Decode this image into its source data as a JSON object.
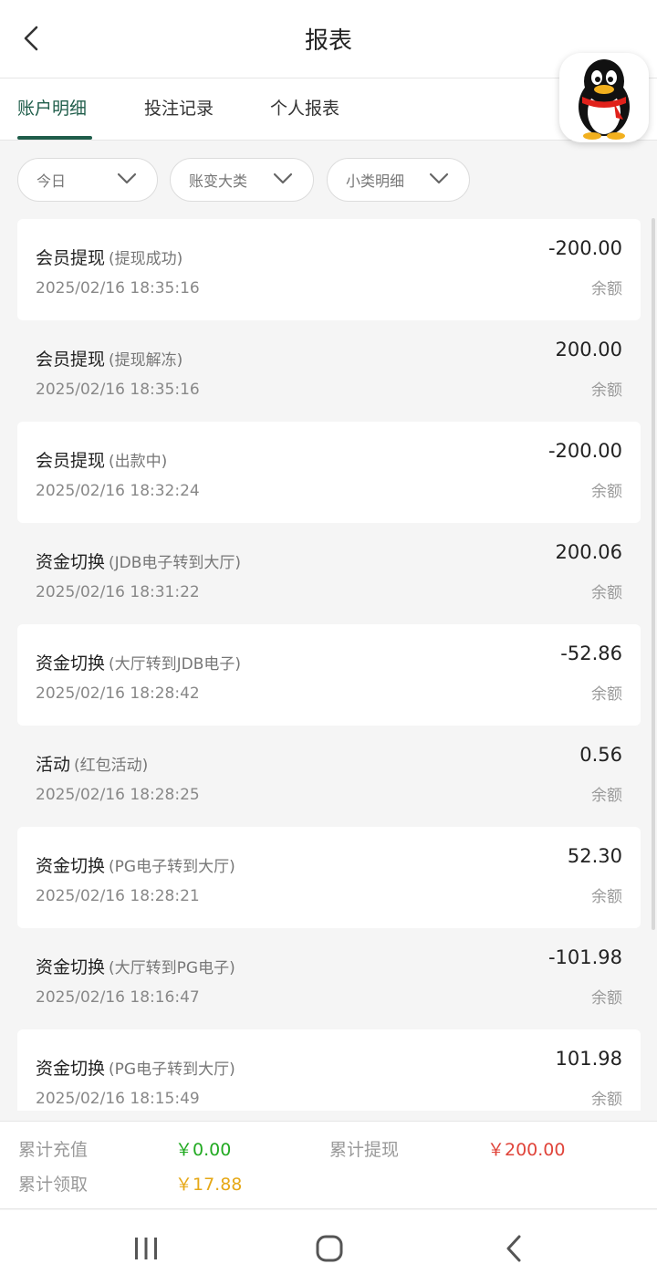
{
  "header": {
    "title": "报表",
    "back_icon": "chevron-left-icon"
  },
  "tabs": [
    {
      "label": "账户明细",
      "active": true
    },
    {
      "label": "投注记录",
      "active": false
    },
    {
      "label": "个人报表",
      "active": false
    }
  ],
  "floating_badge": {
    "icon": "qq-penguin-icon"
  },
  "filters": [
    {
      "label": "今日",
      "icon": "chevron-down-icon"
    },
    {
      "label": "账变大类",
      "icon": "chevron-down-icon"
    },
    {
      "label": "小类明细",
      "icon": "chevron-down-icon"
    }
  ],
  "records": [
    {
      "title": "会员提现",
      "sub": "(提现成功)",
      "time": "2025/02/16 18:35:16",
      "amount": "-200.00",
      "balance_label": "余额"
    },
    {
      "title": "会员提现",
      "sub": "(提现解冻)",
      "time": "2025/02/16 18:35:16",
      "amount": "200.00",
      "balance_label": "余额"
    },
    {
      "title": "会员提现",
      "sub": "(出款中)",
      "time": "2025/02/16 18:32:24",
      "amount": "-200.00",
      "balance_label": "余额"
    },
    {
      "title": "资金切换",
      "sub": "(JDB电子转到大厅)",
      "time": "2025/02/16 18:31:22",
      "amount": "200.06",
      "balance_label": "余额"
    },
    {
      "title": "资金切换",
      "sub": "(大厅转到JDB电子)",
      "time": "2025/02/16 18:28:42",
      "amount": "-52.86",
      "balance_label": "余额"
    },
    {
      "title": "活动",
      "sub": "(红包活动)",
      "time": "2025/02/16 18:28:25",
      "amount": "0.56",
      "balance_label": "余额"
    },
    {
      "title": "资金切换",
      "sub": "(PG电子转到大厅)",
      "time": "2025/02/16 18:28:21",
      "amount": "52.30",
      "balance_label": "余额"
    },
    {
      "title": "资金切换",
      "sub": "(大厅转到PG电子)",
      "time": "2025/02/16 18:16:47",
      "amount": "-101.98",
      "balance_label": "余额"
    },
    {
      "title": "资金切换",
      "sub": "(PG电子转到大厅)",
      "time": "2025/02/16 18:15:49",
      "amount": "101.98",
      "balance_label": "余额"
    }
  ],
  "summary": {
    "recharge_label": "累计充值",
    "recharge_value": "￥0.00",
    "withdraw_label": "累计提现",
    "withdraw_value": "￥200.00",
    "claim_label": "累计领取",
    "claim_value": "￥17.88"
  },
  "colors": {
    "accent": "#1f5d4a",
    "recharge": "#22aa22",
    "withdraw": "#e0443a",
    "claim": "#e6a817"
  },
  "navbar": {
    "icons": [
      "recent-apps-icon",
      "home-icon",
      "back-icon"
    ]
  }
}
